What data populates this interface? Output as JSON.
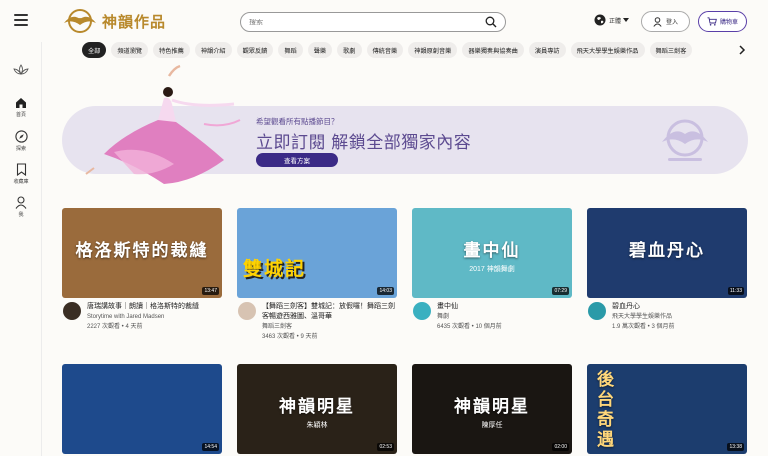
{
  "header": {
    "logo_text": "神韻作品",
    "search_placeholder": "搜索",
    "lang_label": "正體",
    "login_label": "登入",
    "cart_label": "購物車"
  },
  "sidebar": {
    "items": [
      {
        "icon": "lotus-icon",
        "label": ""
      },
      {
        "icon": "home-icon",
        "label": "首頁"
      },
      {
        "icon": "compass-icon",
        "label": "探索"
      },
      {
        "icon": "bookmark-icon",
        "label": "收藏庫"
      },
      {
        "icon": "person-icon",
        "label": "我"
      }
    ]
  },
  "chips": [
    "全部",
    "頻道瀏覽",
    "特色推薦",
    "神韻介紹",
    "觀眾反饋",
    "舞蹈",
    "聲樂",
    "歌劇",
    "傳統音樂",
    "神韻原創音樂",
    "器樂獨奏與協奏曲",
    "演員專訪",
    "飛天大學學生娛樂作品",
    "舞蹈三劍客"
  ],
  "banner": {
    "question": "希望觀看所有點播節目？",
    "title": "立即訂閱 解鎖全部獨家內容",
    "button": "查看方案"
  },
  "videos": [
    {
      "thumb_text": "格洛斯特的裁縫",
      "duration": "13:47",
      "title": "唐瑞講故事｜朗讀｜格洛斯特的裁縫",
      "channel": "Storytime with Jared Madsen",
      "stats": "2227 次觀看 • 4 天前",
      "thumb_bg": "#9a6b3c"
    },
    {
      "thumb_text": "雙城記",
      "duration": "14:03",
      "title": "【舞蹈三劍客】雙城記：放假囉！舞蹈三劍客暢遊西雅圖、溫哥華",
      "channel": "舞蹈三劍客",
      "stats": "3463 次觀看 • 9 天前",
      "thumb_bg": "#6aa3d8"
    },
    {
      "thumb_text": "畫中仙",
      "thumb_sub": "2017 神韻舞劇",
      "duration": "07:29",
      "title": "畫中仙",
      "channel": "舞劇",
      "stats": "6435 次觀看 • 10 個月前",
      "thumb_bg": "#5fb9c6"
    },
    {
      "thumb_text": "碧血丹心",
      "duration": "11:33",
      "title": "碧血丹心",
      "channel": "飛天大學學生娛樂作品",
      "stats": "1.9 萬次觀看 • 3 個月前",
      "thumb_bg": "#1f3b6e"
    },
    {
      "thumb_text": "",
      "duration": "14:54",
      "title": "",
      "channel": "",
      "stats": "",
      "thumb_bg": "#1e4a8c"
    },
    {
      "thumb_text": "神韻明星",
      "thumb_sub": "朱穎林",
      "duration": "02:53",
      "title": "",
      "channel": "",
      "stats": "",
      "thumb_bg": "#2a2218"
    },
    {
      "thumb_text": "神韻明星",
      "thumb_sub": "陳厚任",
      "duration": "02:00",
      "title": "",
      "channel": "",
      "stats": "",
      "thumb_bg": "#1a1612"
    },
    {
      "thumb_text": "後台奇遇",
      "duration": "13:38",
      "title": "",
      "channel": "",
      "stats": "",
      "thumb_bg": "#1c3d6e"
    }
  ],
  "colors": {
    "accent": "#3b2a86",
    "banner_bg": "#e7e3ef",
    "banner_text": "#5c4a90",
    "logo_gold": "#b8892c"
  }
}
